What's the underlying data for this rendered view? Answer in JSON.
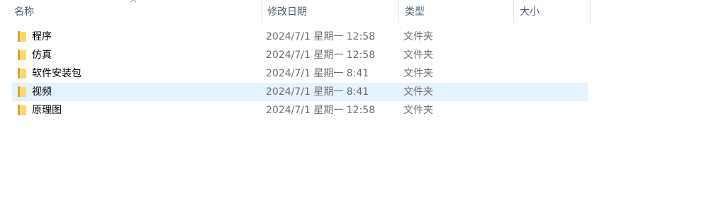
{
  "header": {
    "col_name": "名称",
    "col_date": "修改日期",
    "col_type": "类型",
    "col_size": "大小",
    "sort_icon": "chevron-up-icon"
  },
  "files": [
    {
      "name": "程序",
      "date": "2024/7/1 星期一 12:58",
      "type": "文件夹",
      "size": "",
      "icon": "folder-icon",
      "selected": false
    },
    {
      "name": "仿真",
      "date": "2024/7/1 星期一 12:58",
      "type": "文件夹",
      "size": "",
      "icon": "folder-icon",
      "selected": false
    },
    {
      "name": "软件安装包",
      "date": "2024/7/1 星期一 8:41",
      "type": "文件夹",
      "size": "",
      "icon": "folder-icon",
      "selected": false
    },
    {
      "name": "视频",
      "date": "2024/7/1 星期一 8:41",
      "type": "文件夹",
      "size": "",
      "icon": "folder-icon",
      "selected": true
    },
    {
      "name": "原理图",
      "date": "2024/7/1 星期一 12:58",
      "type": "文件夹",
      "size": "",
      "icon": "folder-icon",
      "selected": false
    }
  ],
  "colors": {
    "header_text": "#4c607a",
    "selected_row": "#e5f3ff",
    "folder": "#f8d775"
  }
}
